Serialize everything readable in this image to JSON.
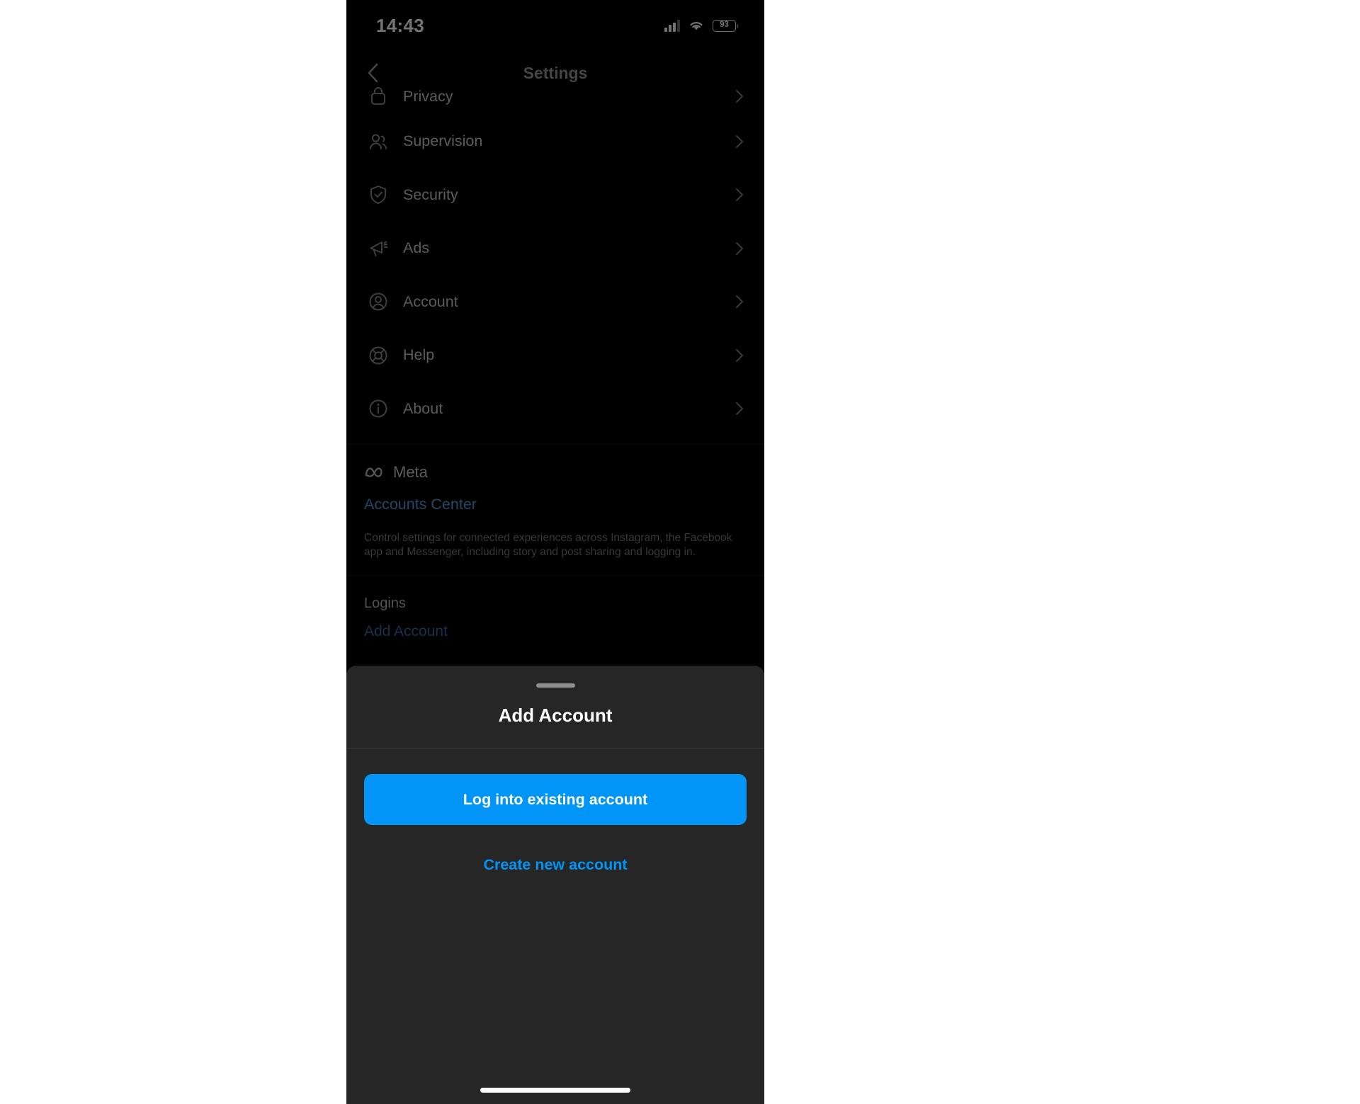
{
  "status_bar": {
    "time": "14:43",
    "battery_level": "93",
    "signal_icon": "cellular-signal-icon",
    "wifi_icon": "wifi-icon",
    "battery_icon": "battery-icon"
  },
  "header": {
    "title": "Settings",
    "back_icon": "chevron-left-icon"
  },
  "settings_list": [
    {
      "label": "Privacy",
      "icon": "lock-icon",
      "chevron": "chevron-right-icon"
    },
    {
      "label": "Supervision",
      "icon": "people-icon",
      "chevron": "chevron-right-icon"
    },
    {
      "label": "Security",
      "icon": "shield-check-icon",
      "chevron": "chevron-right-icon"
    },
    {
      "label": "Ads",
      "icon": "megaphone-icon",
      "chevron": "chevron-right-icon"
    },
    {
      "label": "Account",
      "icon": "person-circle-icon",
      "chevron": "chevron-right-icon"
    },
    {
      "label": "Help",
      "icon": "lifebuoy-icon",
      "chevron": "chevron-right-icon"
    },
    {
      "label": "About",
      "icon": "info-circle-icon",
      "chevron": "chevron-right-icon"
    }
  ],
  "meta_section": {
    "brand_name": "Meta",
    "brand_icon": "meta-infinity-logo",
    "link_label": "Accounts Center",
    "description": "Control settings for connected experiences across Instagram, the Facebook app and Messenger, including story and post sharing and logging in."
  },
  "logins_section": {
    "heading": "Logins",
    "item_label": "Add Account"
  },
  "bottom_sheet": {
    "title": "Add Account",
    "primary_button": "Log into existing account",
    "secondary_button": "Create new account",
    "grabber": "drag-handle"
  },
  "colors": {
    "accent_blue": "#0095F6",
    "link_blue": "#4a9fe0",
    "sheet_bg": "#262626",
    "screen_bg": "#000000"
  }
}
